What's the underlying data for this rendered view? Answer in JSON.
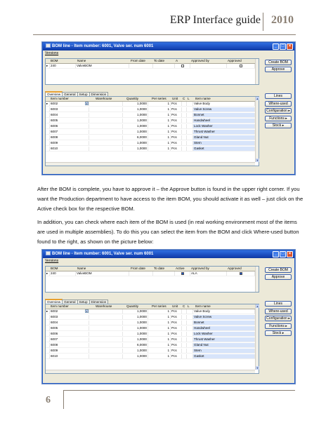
{
  "header": {
    "title": "ERP Interface guide",
    "year": "2010"
  },
  "footer": {
    "page_number": "6"
  },
  "paragraphs": [
    "After the BOM is complete, you have to approve it – the Approve button is found in the upper right corner. If you want the Production department to have access to the item BOM, you should activate it as well – just click on the Active check box for the respective BOM.",
    "In addition, you can check where each item of the BOM is used (in real working environment most of the items are used in multiple assemblies). To do this you can select the item from the BOM and click Where-used button found to the right, as shown on the picture below:"
  ],
  "windows": [
    {
      "title": "BOM line - Item number: 6001, Valve ser. num 6001",
      "menu": "Versions",
      "bom_columns": [
        "BOM",
        "Name",
        "From date",
        "To date",
        "A",
        "Approved by",
        "Approved"
      ],
      "bom_row": {
        "bom": "240",
        "name": "ValveBOM",
        "from": "",
        "to": "",
        "active": false,
        "approved_by": "",
        "approved": false
      },
      "buttons_top": [
        "Create BOM",
        "Approve"
      ],
      "tabs": [
        "Overview",
        "General",
        "Setup",
        "Dimension"
      ],
      "line_columns": [
        "Item number",
        "Warehouse",
        "Quantity",
        "Per series",
        "Unit",
        "C",
        "L",
        "Item name"
      ],
      "lines": [
        {
          "item": "6002",
          "qty": "1,0000",
          "per": "1",
          "unit": "Pcs",
          "name": "Valve Body"
        },
        {
          "item": "6003",
          "qty": "1,0000",
          "per": "1",
          "unit": "Pcs",
          "name": "Valve Screw"
        },
        {
          "item": "6004",
          "qty": "1,0000",
          "per": "1",
          "unit": "Pcs",
          "name": "Bonnet"
        },
        {
          "item": "6005",
          "qty": "1,0000",
          "per": "1",
          "unit": "Pcs",
          "name": "Handwheel"
        },
        {
          "item": "6006",
          "qty": "1,0000",
          "per": "1",
          "unit": "Pcs",
          "name": "Lock Washer"
        },
        {
          "item": "6007",
          "qty": "1,0000",
          "per": "1",
          "unit": "Pcs",
          "name": "Thrust Washer"
        },
        {
          "item": "6008",
          "qty": "6,0000",
          "per": "1",
          "unit": "Pcs",
          "name": "Gland Nut"
        },
        {
          "item": "6009",
          "qty": "1,0000",
          "per": "1",
          "unit": "Pcs",
          "name": "Stem"
        },
        {
          "item": "6010",
          "qty": "1,0000",
          "per": "1",
          "unit": "Pcs",
          "name": "Gasket"
        }
      ],
      "buttons_side": [
        "Lines",
        "Where-used",
        "Configuration",
        "Functions",
        "Stock"
      ]
    },
    {
      "title": "BOM line - Item number: 6001, Valve ser. num 6001",
      "menu": "Versions",
      "bom_columns": [
        "BOM",
        "Name",
        "From date",
        "To date",
        "Active",
        "Approved by",
        "Approved"
      ],
      "bom_row": {
        "bom": "240",
        "name": "ValveBOM",
        "from": "",
        "to": "",
        "active": true,
        "approved_by": "ALA",
        "approved": true
      },
      "buttons_top": [
        "Create BOM",
        "Approve"
      ],
      "tabs": [
        "Overview",
        "General",
        "Setup",
        "Dimension"
      ],
      "line_columns": [
        "Item number",
        "Warehouse",
        "Quantity",
        "Per series",
        "Unit",
        "C",
        "L",
        "Item name"
      ],
      "lines": [
        {
          "item": "6002",
          "qty": "1,0000",
          "per": "1",
          "unit": "Pcs",
          "name": "Valve Body"
        },
        {
          "item": "6003",
          "qty": "1,0000",
          "per": "1",
          "unit": "Pcs",
          "name": "Valve Screw"
        },
        {
          "item": "6004",
          "qty": "1,0000",
          "per": "1",
          "unit": "Pcs",
          "name": "Bonnet"
        },
        {
          "item": "6005",
          "qty": "1,0000",
          "per": "1",
          "unit": "Pcs",
          "name": "Handwheel"
        },
        {
          "item": "6006",
          "qty": "1,0000",
          "per": "1",
          "unit": "Pcs",
          "name": "Lock Washer"
        },
        {
          "item": "6007",
          "qty": "1,0000",
          "per": "1",
          "unit": "Pcs",
          "name": "Thrust Washer"
        },
        {
          "item": "6008",
          "qty": "6,0000",
          "per": "1",
          "unit": "Pcs",
          "name": "Gland Nut"
        },
        {
          "item": "6009",
          "qty": "1,0000",
          "per": "1",
          "unit": "Pcs",
          "name": "Stem"
        },
        {
          "item": "6010",
          "qty": "1,0000",
          "per": "1",
          "unit": "Pcs",
          "name": "Gasket"
        }
      ],
      "buttons_side": [
        "Lines",
        "Where-used",
        "Configuration",
        "Functions",
        "Stock"
      ]
    }
  ]
}
